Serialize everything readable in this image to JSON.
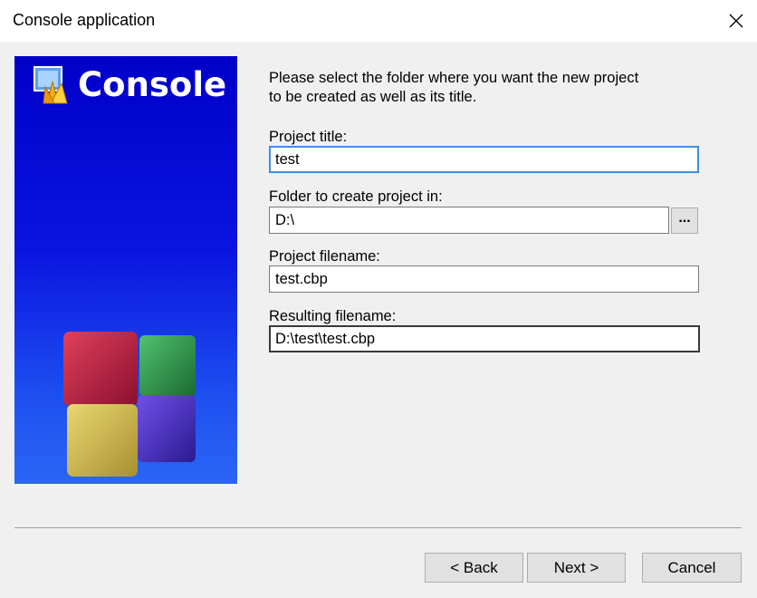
{
  "window": {
    "title": "Console application"
  },
  "banner": {
    "title": "Console"
  },
  "description": "Please select the folder where you want the new project to be created as well as its title.",
  "description_lines": [
    "Please select the folder where you want the new project",
    "to be created as well as its title."
  ],
  "fields": {
    "project_title": {
      "label": "Project title:",
      "value": "test"
    },
    "folder": {
      "label": "Folder to create project in:",
      "value": "D:\\",
      "browse_label": "..."
    },
    "project_filename": {
      "label": "Project filename:",
      "value": "test.cbp"
    },
    "resulting_filename": {
      "label": "Resulting filename:",
      "value": "D:\\test\\test.cbp"
    }
  },
  "buttons": {
    "back": "< Back",
    "next": "Next >",
    "cancel": "Cancel"
  },
  "colors": {
    "banner_blue": "#0000c8",
    "focus_border": "#3c8ee8",
    "dialog_bg": "#f0f0f0"
  }
}
